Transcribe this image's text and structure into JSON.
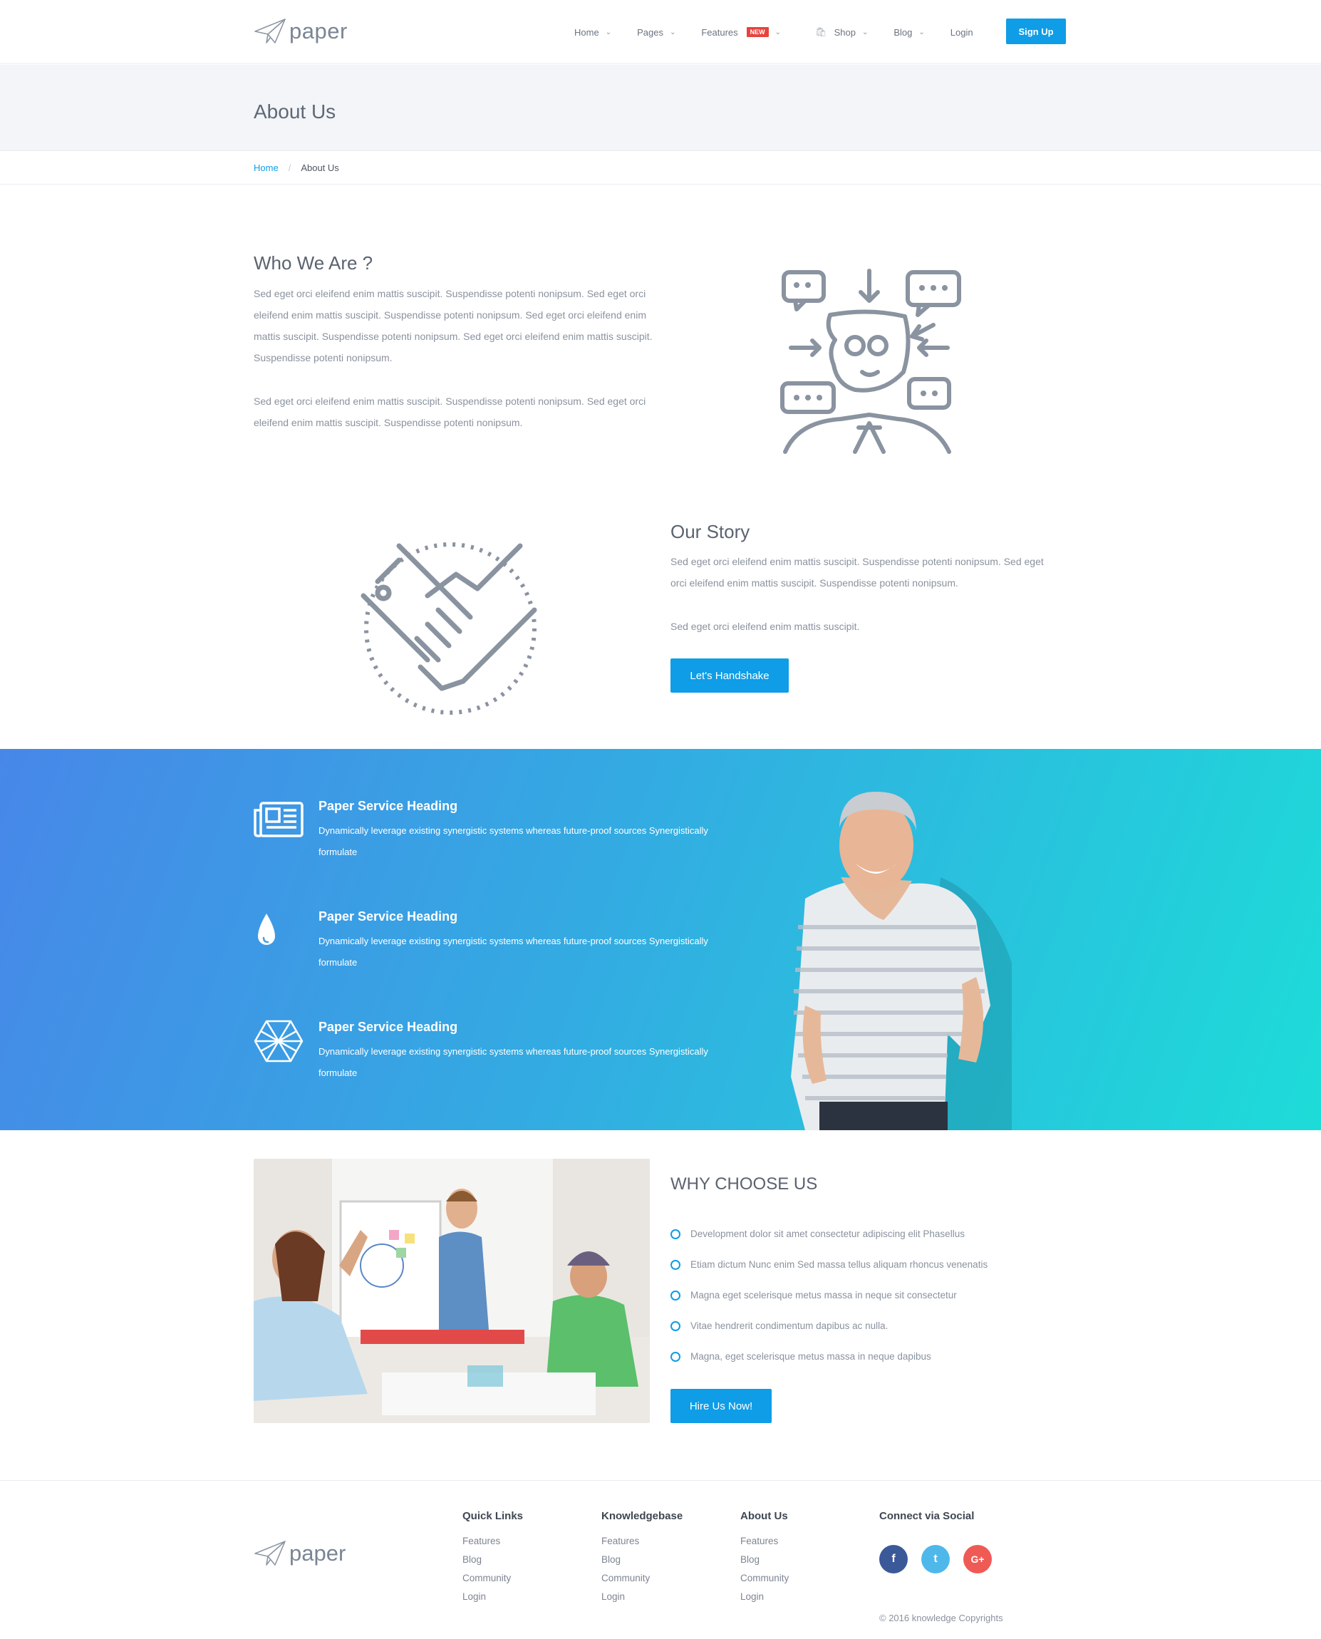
{
  "brand": {
    "name": "paper"
  },
  "nav": {
    "items": [
      {
        "label": "Home"
      },
      {
        "label": "Pages"
      },
      {
        "label": "Features",
        "badge": "NEW"
      },
      {
        "label": "Shop"
      },
      {
        "label": "Blog"
      },
      {
        "label": "Login"
      }
    ],
    "signup_label": "Sign Up"
  },
  "header": {
    "title": "About Us"
  },
  "breadcrumb": {
    "home": "Home",
    "separator": "/",
    "current": "About Us"
  },
  "who": {
    "title": "Who We Are ?",
    "p1": "Sed eget orci eleifend enim mattis suscipit. Suspendisse potenti nonipsum. Sed eget orci eleifend enim mattis suscipit. Suspendisse potenti nonipsum. Sed eget orci eleifend enim mattis suscipit. Suspendisse potenti nonipsum. Sed eget orci eleifend enim mattis suscipit. Suspendisse potenti nonipsum.",
    "p2": "Sed eget orci eleifend enim mattis suscipit. Suspendisse potenti nonipsum. Sed eget orci eleifend enim mattis suscipit. Suspendisse potenti nonipsum."
  },
  "story": {
    "title": "Our Story",
    "p1": "Sed eget orci eleifend enim mattis suscipit. Suspendisse potenti nonipsum. Sed eget orci eleifend enim mattis suscipit. Suspendisse potenti nonipsum.",
    "p2": "Sed eget orci eleifend enim mattis suscipit.",
    "button": "Let's Handshake"
  },
  "services": [
    {
      "icon": "newspaper-icon",
      "title": "Paper Service Heading",
      "desc": "Dynamically leverage existing synergistic systems whereas future-proof sources Synergistically formulate"
    },
    {
      "icon": "drop-icon",
      "title": "Paper Service Heading",
      "desc": "Dynamically leverage existing synergistic systems whereas future-proof sources Synergistically formulate"
    },
    {
      "icon": "hexagon-icon",
      "title": "Paper Service Heading",
      "desc": "Dynamically leverage existing synergistic systems whereas future-proof sources Synergistically formulate"
    }
  ],
  "why": {
    "title": "WHY CHOOSE US",
    "items": [
      "Development dolor sit amet consectetur adipiscing elit Phasellus",
      "Etiam dictum Nunc enim Sed massa tellus aliquam rhoncus venenatis",
      "Magna eget scelerisque metus massa in neque sit consectetur",
      "Vitae hendrerit condimentum dapibus ac nulla.",
      "Magna, eget scelerisque metus massa in neque dapibus"
    ],
    "button": "Hire Us Now!"
  },
  "footer": {
    "columns": [
      {
        "title": "Quick Links",
        "links": [
          "Features",
          "Blog",
          "Community",
          "Login"
        ]
      },
      {
        "title": "Knowledgebase",
        "links": [
          "Features",
          "Blog",
          "Community",
          "Login"
        ]
      },
      {
        "title": "About Us",
        "links": [
          "Features",
          "Blog",
          "Community",
          "Login"
        ]
      }
    ],
    "social_title": "Connect via Social",
    "social": [
      {
        "icon": "facebook-icon",
        "glyph": "f",
        "color": "#3b5998"
      },
      {
        "icon": "twitter-icon",
        "glyph": "t",
        "color": "#4fb8ea"
      },
      {
        "icon": "google-plus-icon",
        "glyph": "G+",
        "color": "#ef5a55"
      }
    ],
    "copyright": "© 2016 knowledge Copyrights"
  },
  "colors": {
    "accent": "#0e9de6",
    "badge": "#e8423d",
    "gradient_start": "#4787e8",
    "gradient_end": "#1ddcd8"
  }
}
